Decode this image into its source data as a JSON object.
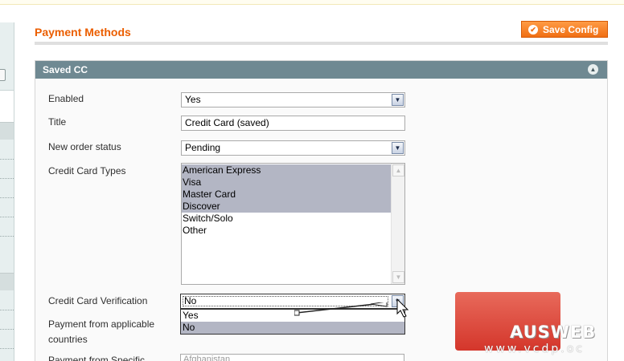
{
  "page": {
    "title": "Payment Methods",
    "save_button": "Save Config"
  },
  "section": {
    "title": "Saved CC"
  },
  "fields": {
    "enabled": {
      "label": "Enabled",
      "value": "Yes"
    },
    "title": {
      "label": "Title",
      "value": "Credit Card (saved)"
    },
    "order_status": {
      "label": "New order status",
      "value": "Pending"
    },
    "cc_types": {
      "label": "Credit Card Types",
      "options": [
        {
          "label": "American Express",
          "selected": true
        },
        {
          "label": "Visa",
          "selected": true
        },
        {
          "label": "Master Card",
          "selected": true
        },
        {
          "label": "Discover",
          "selected": true
        },
        {
          "label": "Switch/Solo",
          "selected": false
        },
        {
          "label": "Other",
          "selected": false
        }
      ]
    },
    "cc_verification": {
      "label": "Credit Card Verification",
      "value": "No",
      "options": [
        "Yes",
        "No"
      ],
      "highlighted": "No"
    },
    "applicable_countries": {
      "label_line1": "Payment from applicable",
      "label_line2": "countries"
    },
    "specific_countries": {
      "label": "Payment from Specific",
      "value": "Afghanistan"
    }
  },
  "watermark": {
    "logo": "AUSWEB",
    "url": "www.vcdp.oc"
  },
  "colors": {
    "accent": "#eb5e00",
    "header": "#6f8992",
    "selected_option": "#b3b6c4",
    "watermark": "#d4362b"
  }
}
